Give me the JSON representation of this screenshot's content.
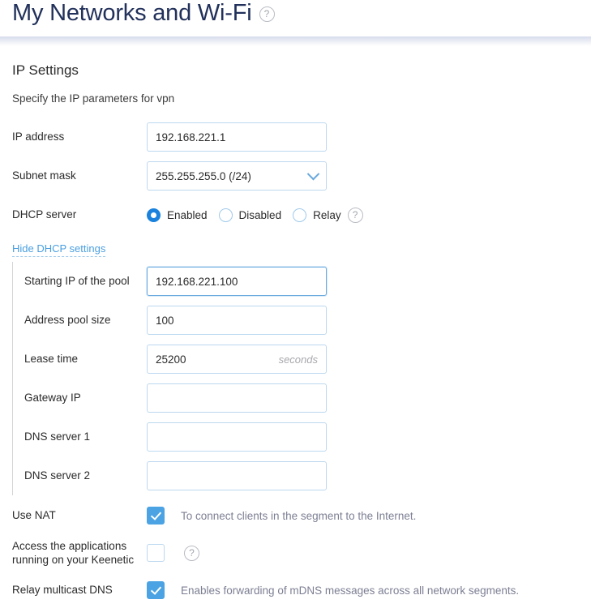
{
  "header": {
    "title": "My Networks and Wi-Fi",
    "help_icon": "question-circle-icon",
    "help_glyph": "?"
  },
  "section": {
    "title": "IP Settings",
    "description": "Specify the IP parameters for vpn"
  },
  "fields": {
    "ip_address": {
      "label": "IP address",
      "value": "192.168.221.1"
    },
    "subnet_mask": {
      "label": "Subnet mask",
      "value": "255.255.255.0 (/24)",
      "chevron_icon": "chevron-down-icon"
    },
    "dhcp_server": {
      "label": "DHCP server",
      "options": [
        {
          "label": "Enabled",
          "checked": true
        },
        {
          "label": "Disabled",
          "checked": false
        },
        {
          "label": "Relay",
          "checked": false
        }
      ],
      "help_glyph": "?"
    },
    "toggle_link": "Hide DHCP settings",
    "starting_ip": {
      "label": "Starting IP of the pool",
      "value": "192.168.221.100"
    },
    "pool_size": {
      "label": "Address pool size",
      "value": "100"
    },
    "lease_time": {
      "label": "Lease time",
      "value": "25200",
      "suffix": "seconds"
    },
    "gateway_ip": {
      "label": "Gateway IP",
      "value": ""
    },
    "dns1": {
      "label": "DNS server 1",
      "value": ""
    },
    "dns2": {
      "label": "DNS server 2",
      "value": ""
    }
  },
  "checkboxes": {
    "use_nat": {
      "label": "Use NAT",
      "checked": true,
      "description": "To connect clients in the segment to the Internet."
    },
    "access_apps": {
      "label_line1": "Access the applications",
      "label_line2": "running on your Keenetic",
      "checked": false,
      "help_glyph": "?"
    },
    "relay_mdns": {
      "label": "Relay multicast DNS",
      "checked": true,
      "description": "Enables forwarding of mDNS messages across all network segments."
    }
  },
  "colors": {
    "title": "#22315b",
    "accent_blue": "#1a82dc",
    "checkbox_blue": "#4ba3e3",
    "link_blue": "#4a9fe0",
    "input_border": "#bcd8ef",
    "muted_text": "#7c7f93"
  }
}
